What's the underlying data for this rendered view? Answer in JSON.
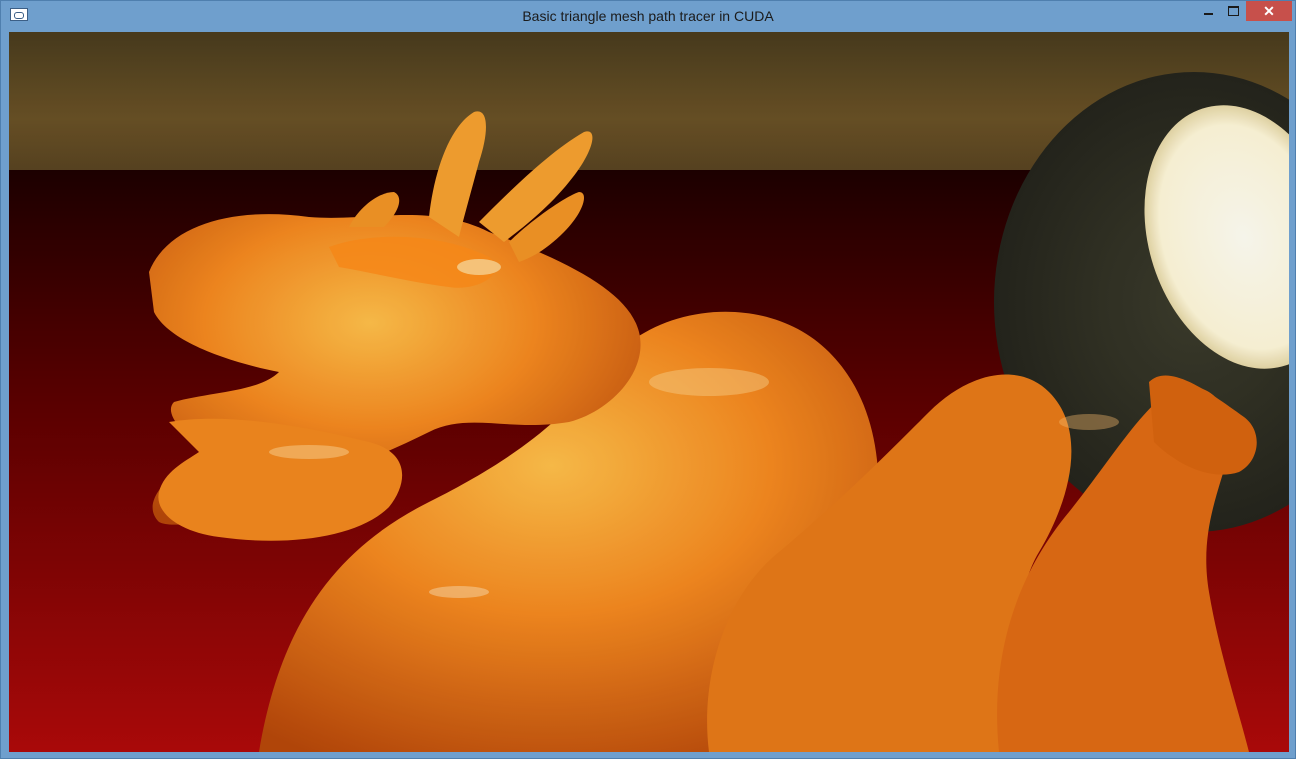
{
  "window": {
    "title": "Basic triangle mesh path tracer in CUDA",
    "icon": "app-window-icon",
    "controls": {
      "minimize_icon": "minimize-icon",
      "maximize_icon": "maximize-icon",
      "close_label": "✕"
    }
  },
  "render": {
    "content": "path-traced orange glossy dragon, red floor, background lamp",
    "colors": {
      "dragon": "#f28a1e",
      "floor": "#8c0a0a",
      "wall": "#5a4520",
      "lamp_light": "#fffbe6"
    }
  }
}
